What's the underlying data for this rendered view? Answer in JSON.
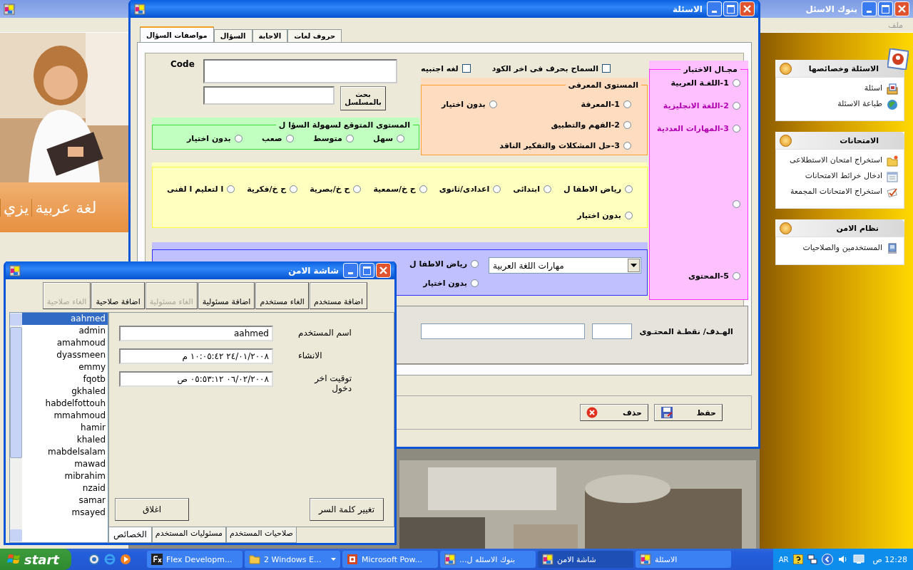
{
  "background_window": {
    "title": "بنوك الاسئل",
    "menu": [
      "ملف"
    ],
    "language_tabs": [
      "لغة عربية",
      "يزي"
    ],
    "task_panels": [
      {
        "title": "الاسئلة وخصائصها",
        "items": [
          {
            "label": "اسئلة",
            "kind": "form"
          },
          {
            "label": "طباعة الاسئلة",
            "kind": "globe"
          }
        ]
      },
      {
        "title": "الامتحانات",
        "items": [
          {
            "label": "استخراج امتحان الاستطلاعى",
            "kind": "folder"
          },
          {
            "label": "ادخال خرائط الامتحانات",
            "kind": "calendar"
          },
          {
            "label": "استخراج الامتحانات المجمعة",
            "kind": "check"
          }
        ]
      },
      {
        "title": "نظام الامن",
        "items": [
          {
            "label": "المستخدمين والصلاحيات",
            "kind": "computer"
          }
        ]
      }
    ]
  },
  "main_window": {
    "title": "الاسئلة",
    "tabs": [
      {
        "label": "حروف لغات",
        "selected": false
      },
      {
        "label": "الاجابة",
        "selected": false
      },
      {
        "label": "السؤال",
        "selected": false
      },
      {
        "label": "مواصفات السؤال",
        "selected": true
      }
    ],
    "code_label": "Code",
    "search_button": "بحث بالمسلسل",
    "checkboxes": [
      {
        "label": "السماح بحرف فى اخر الكود",
        "checked": false
      },
      {
        "label": "لغه اجنبيه",
        "checked": false
      }
    ],
    "difficulty_group": {
      "title": "المستوى المتوقع لسهولة السؤا ل",
      "options": [
        {
          "label": "سهل",
          "selected": false
        },
        {
          "label": "متوسط",
          "selected": false
        },
        {
          "label": "صعب",
          "selected": false
        },
        {
          "label": "بدون اختيار",
          "selected": false
        }
      ]
    },
    "cognitive_group": {
      "title": "المستوى المعرفى",
      "options": [
        {
          "label": "1-المعرفة",
          "kind": "level",
          "selected": false
        },
        {
          "label": "2-الفهم والتطبيق",
          "kind": "level",
          "selected": false
        },
        {
          "label": "3-حل المشكلات والتفكير الناقد",
          "kind": "level",
          "selected": false
        },
        {
          "label": "بدون اختيار",
          "kind": "none",
          "selected": false
        }
      ]
    },
    "stage_group": {
      "options": [
        {
          "label": "رياض الاطفا ل",
          "selected": false
        },
        {
          "label": "ابتدائى",
          "selected": false
        },
        {
          "label": "اعدادى/ثانوى",
          "selected": false
        },
        {
          "label": "ح خ/سمعية",
          "selected": false
        },
        {
          "label": "ح خ/بصرية",
          "selected": false
        },
        {
          "label": "ح خ/فكرية",
          "selected": false
        },
        {
          "label": "ا لتعليم ا لفنى",
          "selected": false
        },
        {
          "label": "بدون اختيار",
          "selected": false
        }
      ]
    },
    "skills_group": {
      "dropdown": "مهارات اللغة العربية",
      "options": [
        {
          "label": "رياض الاطفا ل",
          "selected": false
        },
        {
          "label": "بدون اختيار",
          "selected": false
        }
      ]
    },
    "domain_group": {
      "title": "مجـال الاختبار",
      "options": [
        {
          "label": "1-اللغـة العربية",
          "color": "#000000",
          "selected": false
        },
        {
          "label": "2-اللغة الانجليزية",
          "color": "#b000b0",
          "selected": false
        },
        {
          "label": "3-المهارات العددية",
          "color": "#b000b0",
          "selected": false
        },
        {
          "selected": false
        },
        {
          "label": "5-المحتوى",
          "color": "#000000",
          "selected": false
        }
      ]
    },
    "goal_label": "الهـدف/ نقطـة المحتـوى",
    "buttons": [
      {
        "label": "حفظ",
        "kind": "save"
      },
      {
        "label": "حذف",
        "kind": "delete"
      }
    ]
  },
  "security_window": {
    "title": "شاشة الامن",
    "toolbar": [
      {
        "label": "اضافة مستخدم",
        "disabled": false
      },
      {
        "label": "الغاء مستخدم",
        "disabled": false
      },
      {
        "label": "اضافة مسئولية",
        "disabled": false
      },
      {
        "label": "الغاء مسئولية",
        "disabled": true
      },
      {
        "label": "اضافة صلاحية",
        "disabled": false
      },
      {
        "label": "الغاء صلاحية",
        "disabled": true
      }
    ],
    "users": [
      {
        "name": "aahmed",
        "selected": true
      },
      {
        "name": "admin",
        "selected": false
      },
      {
        "name": "amahmoud",
        "selected": false
      },
      {
        "name": "dyassmeen",
        "selected": false
      },
      {
        "name": "emmy",
        "selected": false
      },
      {
        "name": "fqotb",
        "selected": false
      },
      {
        "name": "gkhaled",
        "selected": false
      },
      {
        "name": "habdelfottouh",
        "selected": false
      },
      {
        "name": "mmahmoud",
        "selected": false
      },
      {
        "name": "hamir",
        "selected": false
      },
      {
        "name": "khaled",
        "selected": false
      },
      {
        "name": "mabdelsalam",
        "selected": false
      },
      {
        "name": "mawad",
        "selected": false
      },
      {
        "name": "mibrahim",
        "selected": false
      },
      {
        "name": "nzaid",
        "selected": false
      },
      {
        "name": "samar",
        "selected": false
      },
      {
        "name": "msayed",
        "selected": false
      }
    ],
    "fields": [
      {
        "label": "اسم المستخدم",
        "value": "aahmed"
      },
      {
        "label": "الانشاء",
        "value": "٢٤/٠١/٢٠٠٨ ١٠:٠٥:٤٢ م"
      },
      {
        "label": "توقيت اخر دخول",
        "value": "٠٦/٠٢/٢٠٠٨ ٠٥:٥٣:١٢ ص"
      }
    ],
    "buttons": [
      "تغيير كلمة السر",
      "اغلاق"
    ],
    "tabs": [
      {
        "label": "صلاحيات المستخدم",
        "selected": false
      },
      {
        "label": "مسئوليات المستخدم",
        "selected": false
      },
      {
        "label": "الخصائص",
        "selected": true
      }
    ]
  },
  "taskbar": {
    "start": "start",
    "tasks": [
      {
        "label": "الاسئلة",
        "kind": "app",
        "selected": false
      },
      {
        "label": "شاشة الامن",
        "kind": "app",
        "selected": true
      },
      {
        "label": "بنوك الاسئله ل...",
        "kind": "app",
        "selected": false
      },
      {
        "label": "Microsoft Pow...",
        "kind": "ppt",
        "selected": false
      },
      {
        "label": "2 Windows E...",
        "kind": "folder",
        "selected": false
      },
      {
        "label": "Flex Developm...",
        "kind": "fx",
        "selected": false
      }
    ],
    "language": "AR",
    "clock": "12:28 ص"
  }
}
